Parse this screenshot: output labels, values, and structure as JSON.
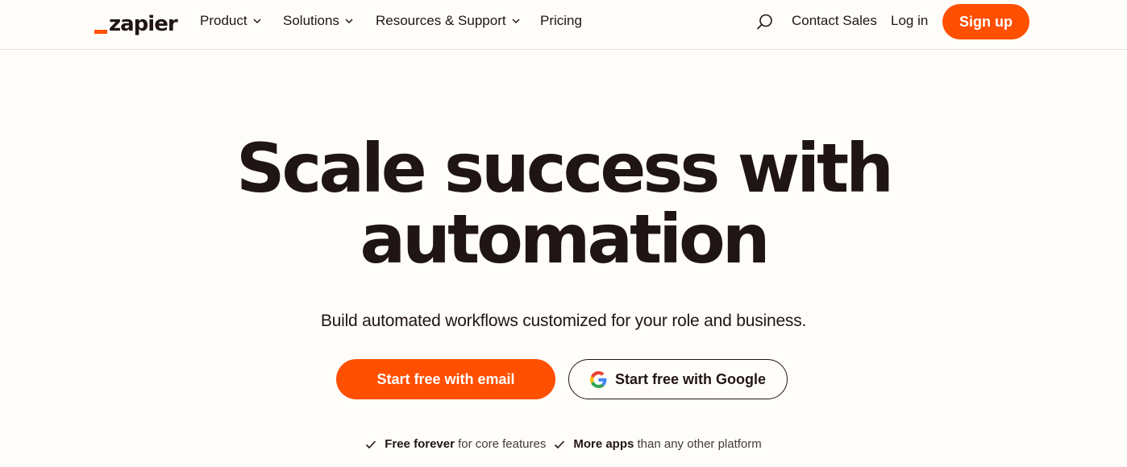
{
  "brand": {
    "name": "zapier",
    "accent": "#ff4f00",
    "text": "#201515",
    "background": "#fffdf9"
  },
  "nav": {
    "items": [
      {
        "label": "Product",
        "has_dropdown": true
      },
      {
        "label": "Solutions",
        "has_dropdown": true
      },
      {
        "label": "Resources & Support",
        "has_dropdown": true
      },
      {
        "label": "Pricing",
        "has_dropdown": false
      }
    ],
    "search_icon": "search-icon",
    "contact_sales": "Contact Sales",
    "log_in": "Log in",
    "sign_up": "Sign up"
  },
  "hero": {
    "headline_line1": "Scale success with",
    "headline_line2": "automation",
    "subheadline": "Build automated workflows customized for your role and business.",
    "cta_email": "Start free with email",
    "cta_google": "Start free with Google",
    "features": [
      {
        "bold": "Free forever",
        "rest": " for core features"
      },
      {
        "bold": "More apps",
        "rest": " than any other platform"
      }
    ]
  }
}
